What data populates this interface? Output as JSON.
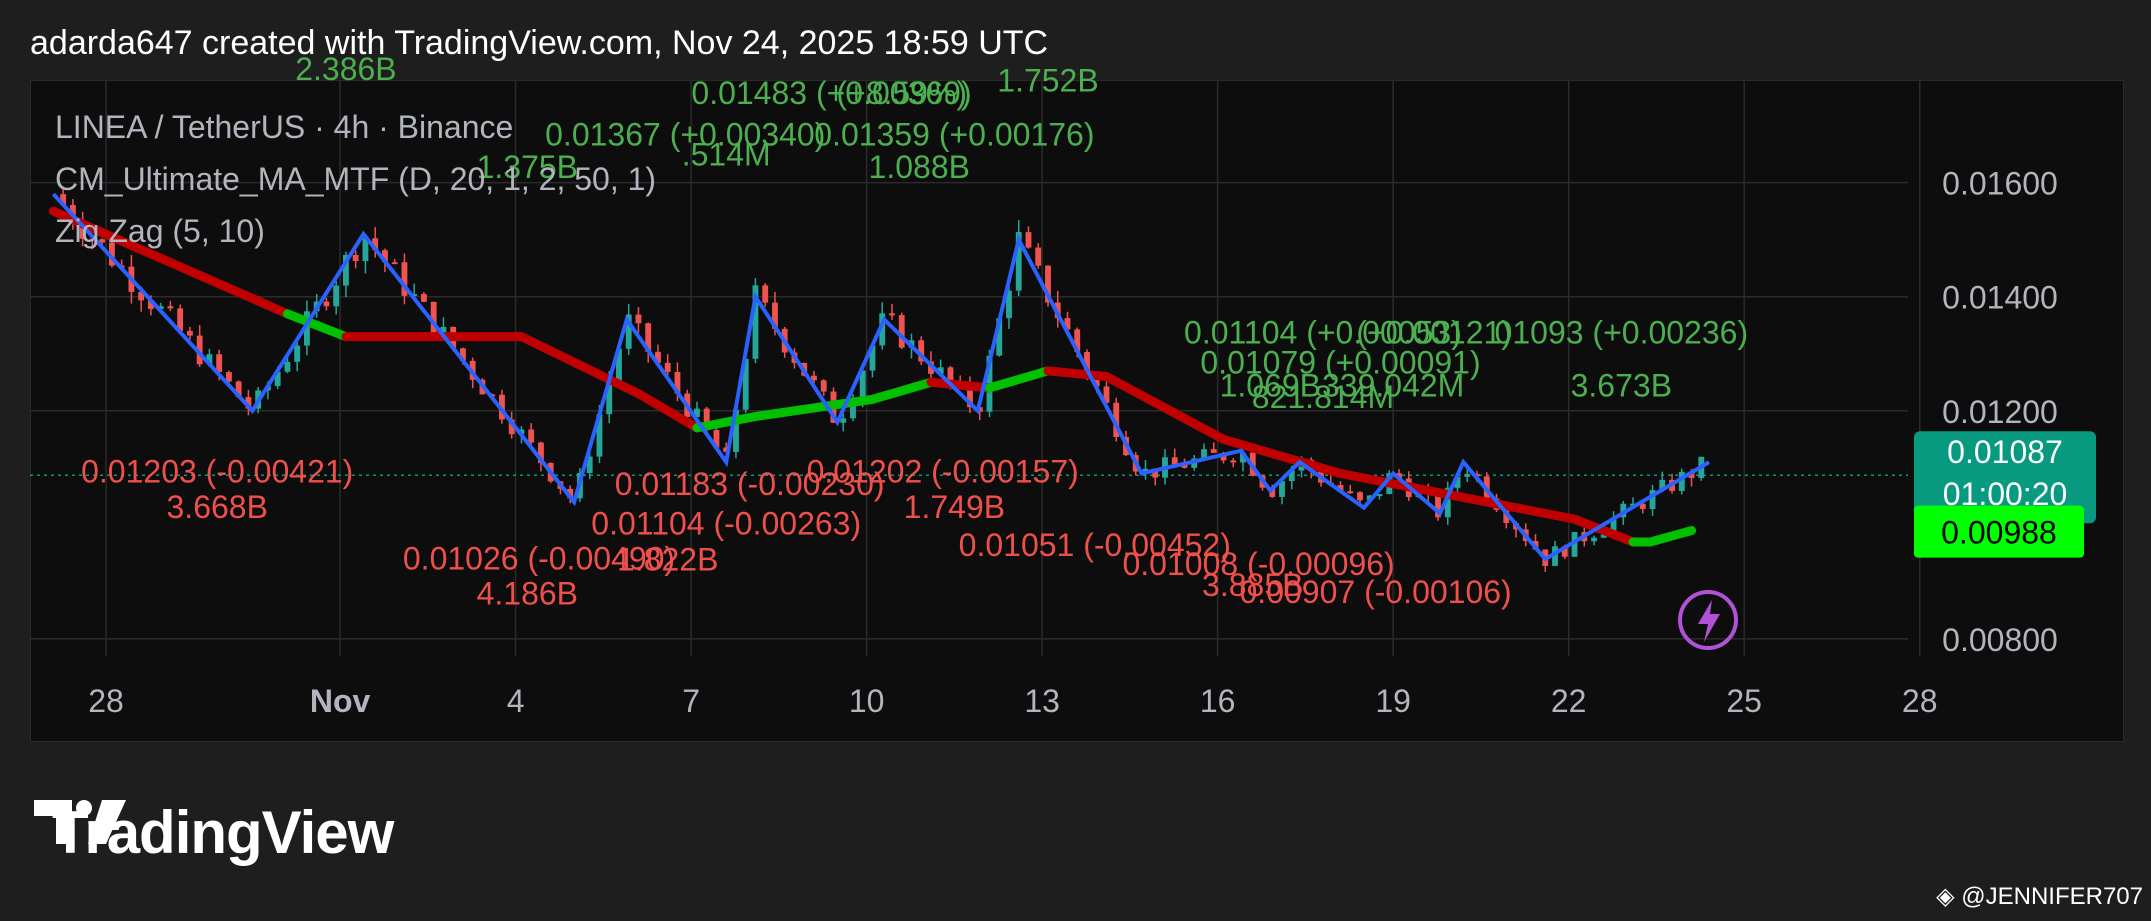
{
  "header": {
    "text": "adarda647 created with TradingView.com, Nov 24, 2025 18:59 UTC"
  },
  "legend": {
    "symbol": "LINEA / TetherUS · 4h · Binance",
    "ma_indicator": "CM_Ultimate_MA_MTF (D, 20, 1, 2, 50, 1)",
    "zigzag_indicator": "Zig Zag (5, 10)"
  },
  "colors": {
    "background": "#1e1e1e",
    "chart_bg": "#0d0d0d",
    "grid": "#2b2b2b",
    "up": "#26a69a",
    "down": "#ef5350",
    "zigzag": "#2962ff",
    "ma_red": "#c00000",
    "ma_green": "#00c000",
    "label_up": "#4caf50",
    "label_down": "#f0504c",
    "price_badge": "#089981",
    "ma_badge": "#00ff00"
  },
  "chart_data": {
    "type": "candlestick",
    "title": "LINEA / TetherUS · 4h · Binance",
    "xlabel": "",
    "ylabel": "",
    "x_ticks": [
      "28",
      "Nov",
      "4",
      "7",
      "10",
      "13",
      "16",
      "19",
      "22",
      "25",
      "28"
    ],
    "y_ticks": [
      "0.01600",
      "0.01400",
      "0.01200",
      "0.00800"
    ],
    "ylim": [
      0.0077,
      0.0178
    ],
    "x_domain": [
      "Oct 27",
      "Nov 28"
    ],
    "grid": true,
    "last_price": {
      "value": "0.01087",
      "countdown": "01:00:20"
    },
    "ma_value": "0.00988",
    "zigzag_pivots": [
      {
        "day": 27.0,
        "price": 0.0158
      },
      {
        "day": 30.4,
        "price": 0.012
      },
      {
        "day": 32.3,
        "price": 0.0151
      },
      {
        "day": 35.9,
        "price": 0.0104
      },
      {
        "day": 36.8,
        "price": 0.0136
      },
      {
        "day": 38.5,
        "price": 0.0111
      },
      {
        "day": 39.0,
        "price": 0.014
      },
      {
        "day": 40.4,
        "price": 0.0118
      },
      {
        "day": 41.2,
        "price": 0.0136
      },
      {
        "day": 42.8,
        "price": 0.012
      },
      {
        "day": 43.5,
        "price": 0.015
      },
      {
        "day": 45.6,
        "price": 0.0109
      },
      {
        "day": 47.3,
        "price": 0.0113
      },
      {
        "day": 47.8,
        "price": 0.0106
      },
      {
        "day": 48.3,
        "price": 0.0111
      },
      {
        "day": 49.4,
        "price": 0.0103
      },
      {
        "day": 49.9,
        "price": 0.0109
      },
      {
        "day": 50.7,
        "price": 0.0102
      },
      {
        "day": 51.1,
        "price": 0.0111
      },
      {
        "day": 52.5,
        "price": 0.0094
      },
      {
        "day": 55.3,
        "price": 0.0111
      }
    ],
    "ma_line": [
      {
        "day": 27.0,
        "price": 0.0155,
        "trend": "down"
      },
      {
        "day": 29.0,
        "price": 0.0146,
        "trend": "down"
      },
      {
        "day": 31.0,
        "price": 0.0137,
        "trend": "down"
      },
      {
        "day": 32.0,
        "price": 0.0133,
        "trend": "up"
      },
      {
        "day": 33.5,
        "price": 0.0133,
        "trend": "down"
      },
      {
        "day": 35.0,
        "price": 0.0133,
        "trend": "down"
      },
      {
        "day": 37.0,
        "price": 0.0123,
        "trend": "down"
      },
      {
        "day": 38.0,
        "price": 0.0117,
        "trend": "down"
      },
      {
        "day": 39.0,
        "price": 0.0119,
        "trend": "up"
      },
      {
        "day": 41.0,
        "price": 0.0122,
        "trend": "up"
      },
      {
        "day": 42.0,
        "price": 0.0125,
        "trend": "up"
      },
      {
        "day": 43.0,
        "price": 0.0124,
        "trend": "down"
      },
      {
        "day": 44.0,
        "price": 0.0127,
        "trend": "up"
      },
      {
        "day": 45.0,
        "price": 0.0126,
        "trend": "down"
      },
      {
        "day": 47.0,
        "price": 0.0115,
        "trend": "down"
      },
      {
        "day": 49.0,
        "price": 0.0109,
        "trend": "down"
      },
      {
        "day": 51.0,
        "price": 0.0105,
        "trend": "down"
      },
      {
        "day": 53.0,
        "price": 0.0101,
        "trend": "down"
      },
      {
        "day": 54.0,
        "price": 0.0097,
        "trend": "down"
      },
      {
        "day": 54.3,
        "price": 0.0097,
        "trend": "up"
      },
      {
        "day": 55.0,
        "price": 0.0099,
        "trend": "up"
      }
    ],
    "zigzag_labels_up": [
      {
        "day": 32.0,
        "price": 0.0178,
        "text": "2.386B"
      },
      {
        "day": 40.3,
        "price": 0.01738,
        "text": "0.01483 (+0.00369)"
      },
      {
        "day": 41.5,
        "price": 0.01738,
        "text": "(+8.59%)"
      },
      {
        "day": 44.0,
        "price": 0.0176,
        "text": "1.752B"
      },
      {
        "day": 37.8,
        "price": 0.01665,
        "text": "0.01367 (+0.00340)"
      },
      {
        "day": 42.4,
        "price": 0.01665,
        "text": "0.01359 (+0.00176)"
      },
      {
        "day": 38.5,
        "price": 0.0163,
        "text": ".514M"
      },
      {
        "day": 35.1,
        "price": 0.01608,
        "text": "1.375B"
      },
      {
        "day": 41.8,
        "price": 0.01608,
        "text": "1.088B"
      },
      {
        "day": 48.7,
        "price": 0.01318,
        "text": "0.01104 (+0.00053)"
      },
      {
        "day": 50.6,
        "price": 0.01318,
        "text": "(+0.00121)"
      },
      {
        "day": 53.8,
        "price": 0.01318,
        "text": "01093 (+0.00236)"
      },
      {
        "day": 49.0,
        "price": 0.01265,
        "text": "0.01079 (+0.00091)"
      },
      {
        "day": 47.8,
        "price": 0.01225,
        "text": "1.069B"
      },
      {
        "day": 49.9,
        "price": 0.01225,
        "text": "339.042M"
      },
      {
        "day": 53.8,
        "price": 0.01225,
        "text": "3.673B"
      },
      {
        "day": 48.7,
        "price": 0.01205,
        "text": "821.814M"
      }
    ],
    "zigzag_labels_down": [
      {
        "day": 29.8,
        "price": 0.01074,
        "text": "0.01203 (-0.00421)"
      },
      {
        "day": 29.8,
        "price": 0.01012,
        "text": "3.668B"
      },
      {
        "day": 38.9,
        "price": 0.01052,
        "text": "0.01183 (-0.00230)"
      },
      {
        "day": 42.2,
        "price": 0.01074,
        "text": "0.01202 (-0.00157)"
      },
      {
        "day": 42.4,
        "price": 0.01012,
        "text": "1.749B"
      },
      {
        "day": 38.5,
        "price": 0.00983,
        "text": "0.01104 (-0.00263)"
      },
      {
        "day": 37.5,
        "price": 0.0092,
        "text": "1.822B"
      },
      {
        "day": 35.3,
        "price": 0.00922,
        "text": "0.01026 (-0.00490)"
      },
      {
        "day": 35.1,
        "price": 0.0086,
        "text": "4.186B"
      },
      {
        "day": 44.8,
        "price": 0.00945,
        "text": "0.01051 (-0.00452)"
      },
      {
        "day": 47.6,
        "price": 0.00912,
        "text": "0.01008 (-0.00096)"
      },
      {
        "day": 47.5,
        "price": 0.00875,
        "text": "3.885B"
      },
      {
        "day": 49.6,
        "price": 0.00863,
        "text": "0.00907 (-0.00106)"
      }
    ]
  }
}
